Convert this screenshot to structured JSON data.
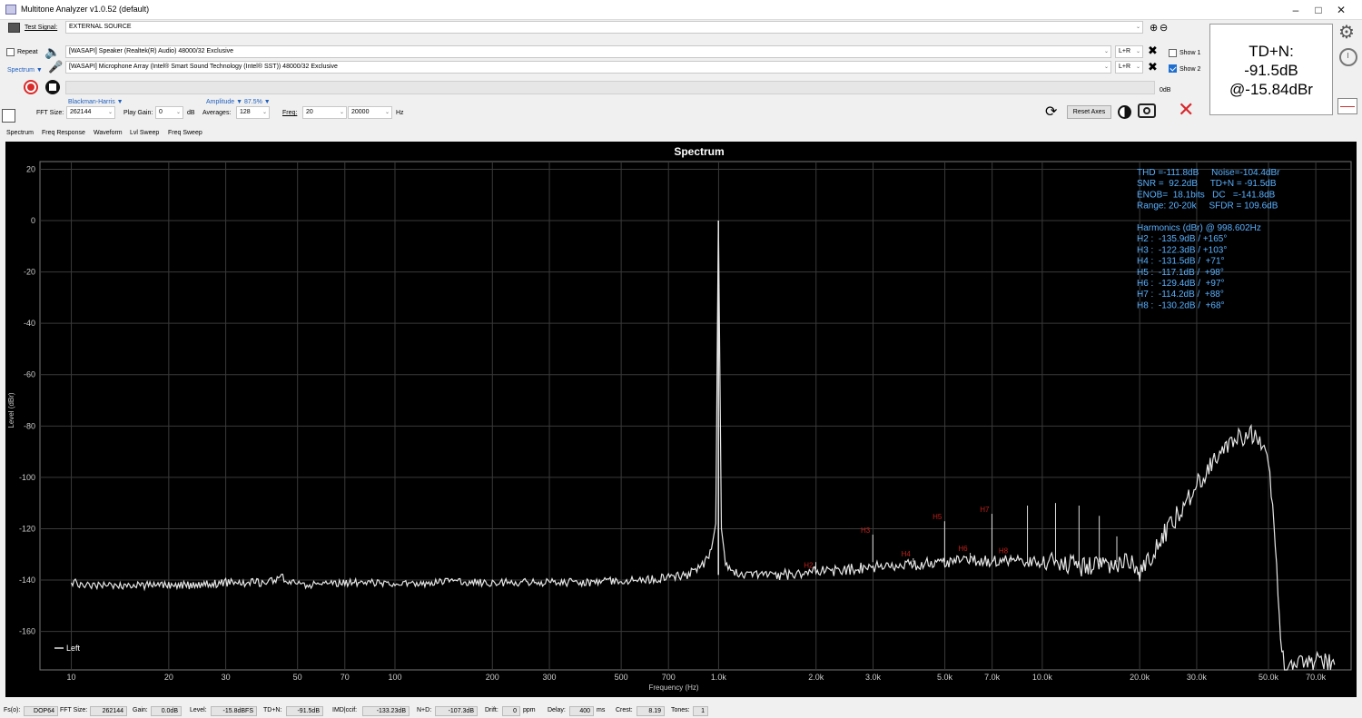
{
  "window": {
    "title": "Multitone Analyzer v1.0.52 (default)"
  },
  "toolbar": {
    "test_signal_label": "Test Signal:",
    "test_signal_value": "EXTERNAL SOURCE",
    "repeat_label": "Repeat",
    "spectrum_menu": "Spectrum ▼",
    "output_device": "[WASAPI] Speaker (Realtek(R) Audio) 48000/32 Exclusive",
    "input_device": "[WASAPI] Microphone Array (Intel® Smart Sound Technology (Intel® SST)) 48000/32 Exclusive",
    "output_channel": "L+R",
    "input_channel": "L+R",
    "show1": "Show 1",
    "show2": "Show 2",
    "level_db": "0dB",
    "window_func": "Blackman-Harris ▼",
    "amplitude_label": "Amplitude ▼",
    "amplitude_value": "87.5%",
    "amplitude_arrow": "▼",
    "fft_size_label": "FFT Size:",
    "fft_size": "262144",
    "play_gain_label": "Play Gain:",
    "play_gain": "0",
    "play_gain_unit": "dB",
    "averages_label": "Averages:",
    "averages": "128",
    "freq_label": "Freq:",
    "freq_from": "20",
    "freq_to": "20000",
    "freq_unit": "Hz",
    "reset_axes": "Reset Axes"
  },
  "tdn_box": {
    "line1": "TD+N:",
    "line2": "-91.5dB",
    "line3": "@-15.84dBr"
  },
  "tabs": [
    "Spectrum",
    "Freq Response",
    "Waveform",
    "Lvl Sweep",
    "Freq Sweep"
  ],
  "chart_data": {
    "type": "line",
    "title": "Spectrum",
    "xlabel": "Frequency (Hz)",
    "ylabel": "Level (dBr)",
    "xscale": "log",
    "xlim": [
      8,
      90000
    ],
    "ylim": [
      -175,
      23
    ],
    "xticks": [
      10,
      20,
      30,
      50,
      70,
      100,
      200,
      300,
      500,
      700,
      1000,
      2000,
      3000,
      5000,
      7000,
      10000,
      20000,
      30000,
      50000,
      70000
    ],
    "xticklabels": [
      "10",
      "20",
      "30",
      "50",
      "70",
      "100",
      "200",
      "300",
      "500",
      "700",
      "1.0k",
      "2.0k",
      "3.0k",
      "5.0k",
      "7.0k",
      "10.0k",
      "20.0k",
      "30.0k",
      "50.0k",
      "70.0k"
    ],
    "yticks": [
      20,
      0,
      -20,
      -40,
      -60,
      -80,
      -100,
      -120,
      -140,
      -160
    ],
    "grid": true,
    "legend": "bottom-left",
    "series": [
      {
        "name": "Left",
        "color": "#e6e6e6",
        "x": [
          10,
          12,
          15,
          20,
          25,
          30,
          40,
          45,
          50,
          70,
          100,
          150,
          200,
          300,
          400,
          500,
          600,
          700,
          800,
          900,
          950,
          980,
          998.6,
          1020,
          1050,
          1100,
          1200,
          1500,
          2000,
          2500,
          3000,
          4000,
          5000,
          6000,
          7000,
          8000,
          9000,
          10000,
          12000,
          14000,
          16000,
          18000,
          19500,
          20000,
          21000,
          23000,
          26000,
          30000,
          35000,
          40000,
          43000,
          45000,
          47000,
          50000,
          52000,
          54000,
          56000,
          60000,
          70000,
          80000
        ],
        "y": [
          -141,
          -142,
          -142,
          -142,
          -142,
          -141,
          -141,
          -139,
          -142,
          -141,
          -141,
          -141,
          -141,
          -141,
          -141,
          -140,
          -140,
          -139,
          -138,
          -134,
          -128,
          -118,
          0,
          -120,
          -133,
          -137,
          -138,
          -138,
          -137,
          -136,
          -135,
          -134,
          -133,
          -132.5,
          -132.5,
          -132.5,
          -133,
          -133,
          -134,
          -135,
          -134,
          -133,
          -135,
          -137,
          -133,
          -125,
          -115,
          -103,
          -92,
          -85,
          -83,
          -83,
          -86,
          -95,
          -120,
          -155,
          -175,
          -174,
          -172,
          -173
        ]
      }
    ],
    "harmonics": [
      {
        "label": "H2",
        "freq": 1997.2,
        "level": -135.9
      },
      {
        "label": "H3",
        "freq": 2995.8,
        "level": -122.3
      },
      {
        "label": "H4",
        "freq": 3994.4,
        "level": -131.5
      },
      {
        "label": "H5",
        "freq": 4993.0,
        "level": -117.1
      },
      {
        "label": "H6",
        "freq": 5991.6,
        "level": -129.4
      },
      {
        "label": "H7",
        "freq": 6990.2,
        "level": -114.2
      },
      {
        "label": "H8",
        "freq": 7988.8,
        "level": -130.2
      }
    ],
    "spurs": [
      {
        "freq": 9000,
        "level": -111
      },
      {
        "freq": 10990,
        "level": -110
      },
      {
        "freq": 12990,
        "level": -111
      },
      {
        "freq": 15000,
        "level": -115
      },
      {
        "freq": 17000,
        "level": -123
      }
    ],
    "stats": [
      "THD =-111.8dB     Noise=-104.4dBr",
      "SNR =  92.2dB     TD+N = -91.5dB",
      "ENOB=  18.1bits   DC   =-141.8dB",
      "Range: 20-20k     SFDR = 109.6dB",
      "",
      "Harmonics (dBr) @ 998.602Hz",
      "H2 :  -135.9dB / +165°",
      "H3 :  -122.3dB / +103°",
      "H4 :  -131.5dB /  +71°",
      "H5 :  -117.1dB /  +98°",
      "H6 :  -129.4dB /  +97°",
      "H7 :  -114.2dB /  +88°",
      "H8 :  -130.2dB /  +68°"
    ]
  },
  "status": {
    "fs_label": "Fs(o):",
    "fs": "DOP64",
    "fft_label": "FFT Size:",
    "fft": "262144",
    "gain_label": "Gain:",
    "gain": "0.0dB",
    "level_label": "Level:",
    "level": "-15.8dBFS",
    "tdn_label": "TD+N:",
    "tdn": "-91.5dB",
    "imd_label": "IMD|ccif:",
    "imd": "-133.23dB",
    "nd_label": "N+D:",
    "nd": "-107.3dB",
    "drift_label": "Drift:",
    "drift": "0",
    "drift_unit": "ppm",
    "delay_label": "Delay:",
    "delay": "400",
    "delay_unit": "ms",
    "crest_label": "Crest:",
    "crest": "8.19",
    "tones_label": "Tones:",
    "tones": "1"
  }
}
